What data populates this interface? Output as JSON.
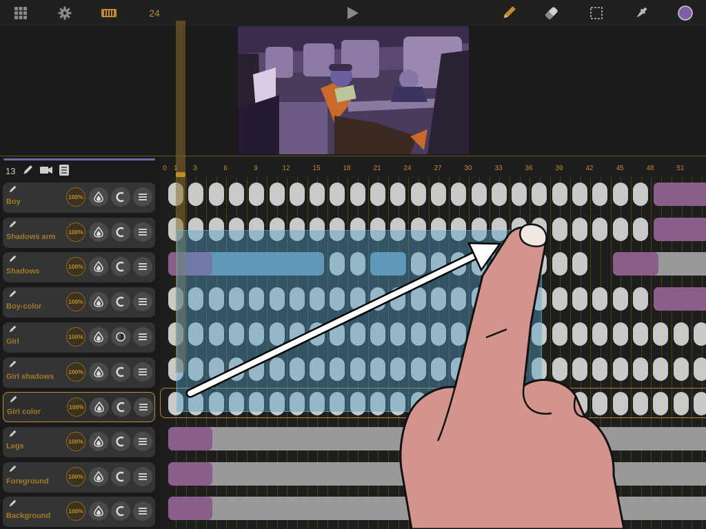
{
  "toolbar": {
    "fps": "24",
    "icons": [
      "grid-icon",
      "gear-icon",
      "filmstrip-icon",
      "play-icon",
      "pencil-icon",
      "eraser-icon",
      "selection-icon",
      "eyedropper-icon",
      "color-swatch-icon"
    ],
    "color_swatch": "#7f5faa"
  },
  "layers_panel": {
    "count": "13",
    "opacity_label": "100%",
    "layers": [
      {
        "name": "Boy"
      },
      {
        "name": "Shadows arm"
      },
      {
        "name": "Shadows"
      },
      {
        "name": "Boy-color"
      },
      {
        "name": "Girl"
      },
      {
        "name": "Girl shadows"
      },
      {
        "name": "Girl color",
        "selected": true
      },
      {
        "name": "Legs"
      },
      {
        "name": "Foreground"
      },
      {
        "name": "Background"
      }
    ]
  },
  "timeline": {
    "ruler_ticks": [
      "0",
      "1",
      "3",
      "6",
      "9",
      "12",
      "15",
      "18",
      "21",
      "24",
      "27",
      "30",
      "33",
      "36",
      "39",
      "42",
      "45",
      "48",
      "51"
    ],
    "current_frame": "1"
  },
  "colors": {
    "accent": "#c08d2a",
    "selection": "#50a0c8",
    "background": "#1c1c1c"
  }
}
